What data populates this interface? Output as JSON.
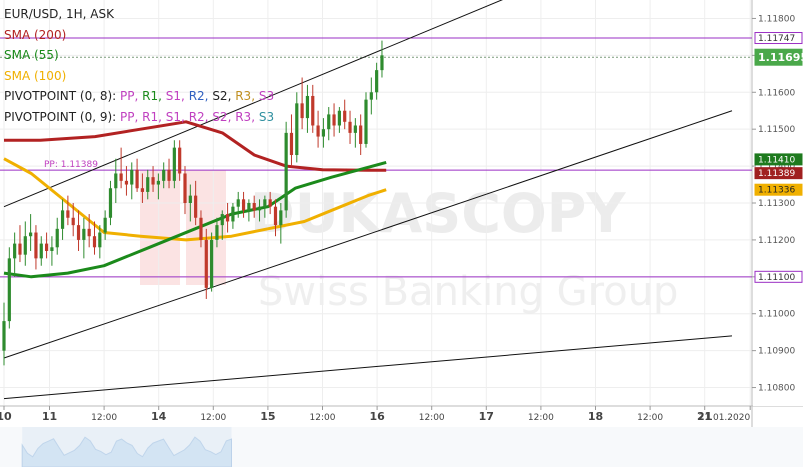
{
  "legend": {
    "symbol": "EUR/USD, 1H, ASK",
    "sma200": "SMA (200)",
    "sma55": "SMA (55)",
    "sma100": "SMA (100)",
    "pivot1_prefix": "PIVOTPOINT (0, 8):",
    "pivot2_prefix": "PIVOTPOINT (0, 9):",
    "pivot_levels": [
      "PP,",
      "R1,",
      "S1,",
      "R2,",
      "S2,",
      "R3,",
      "S3"
    ]
  },
  "colors": {
    "sma200": "#b22222",
    "sma55": "#1b8a1b",
    "sma100": "#f0b000",
    "pivot": "#9a2fc4",
    "bull": "#2e8b2e",
    "bear": "#c0392b",
    "pp": "#c040c0",
    "r1": "#1b8a1b",
    "s1": "#c040c0",
    "r2": "#3060c0",
    "s2": "#c040c0",
    "r3": "#c09020",
    "s3": "#c040c0",
    "r3b": "#c040c0",
    "s3b": "#3090a0"
  },
  "watermark": {
    "brand": "DUKASCOPY",
    "sub": "Swiss Banking Group"
  },
  "chart_data": {
    "type": "candlestick",
    "symbol": "EUR/USD",
    "timeframe": "1H",
    "ylim": [
      1.1075,
      1.1185
    ],
    "y_ticks": [
      "1.11800",
      "1.11700",
      "1.11600",
      "1.11500",
      "1.11400",
      "1.11300",
      "1.11200",
      "1.11100",
      "1.11000",
      "1.10900",
      "1.10800"
    ],
    "x_ticks": [
      {
        "label": "10",
        "t": 0
      },
      {
        "label": "11",
        "t": 10
      },
      {
        "label": "12:00",
        "t": 22
      },
      {
        "label": "14",
        "t": 34
      },
      {
        "label": "12:00",
        "t": 46
      },
      {
        "label": "15",
        "t": 58
      },
      {
        "label": "12:00",
        "t": 70
      },
      {
        "label": "16",
        "t": 82
      },
      {
        "label": "12:00",
        "t": 94
      },
      {
        "label": "17",
        "t": 106
      },
      {
        "label": "12:00",
        "t": 118
      },
      {
        "label": "18",
        "t": 130
      },
      {
        "label": "12:00",
        "t": 142
      },
      {
        "label": "21",
        "t": 154
      },
      {
        "label": "21.01.2020",
        "t": 164
      }
    ],
    "price_labels": [
      {
        "text": "1.11747",
        "value": 1.11747,
        "style": "purple-outline"
      },
      {
        "text": "1.11695",
        "value": 1.11695,
        "style": "green-fill"
      },
      {
        "text": "1.11410",
        "value": 1.1141,
        "style": "darkgreen-fill"
      },
      {
        "text": "1.11389",
        "value": 1.11389,
        "style": "red-fill"
      },
      {
        "text": "1.11336",
        "value": 1.11336,
        "style": "yellow-fill"
      },
      {
        "text": "1.11100",
        "value": 1.111,
        "style": "purple-outline"
      }
    ],
    "pivot_label": {
      "text": "PP: 1.11389",
      "value": 1.11389
    },
    "horizontal_lines": [
      {
        "value": 1.11747,
        "color": "#9a2fc4"
      },
      {
        "value": 1.11389,
        "color": "#9a2fc4"
      },
      {
        "value": 1.111,
        "color": "#9a2fc4"
      }
    ],
    "trendlines": [
      {
        "t1": 0,
        "v1": 1.1129,
        "t2": 125,
        "v2": 1.1193
      },
      {
        "t1": 0,
        "v1": 1.1088,
        "t2": 160,
        "v2": 1.1155
      },
      {
        "t1": 0,
        "v1": 1.1077,
        "t2": 160,
        "v2": 1.1094
      }
    ],
    "candles": [
      {
        "o": 1.109,
        "h": 1.1103,
        "l": 1.1086,
        "c": 1.1098
      },
      {
        "o": 1.1098,
        "h": 1.1118,
        "l": 1.1096,
        "c": 1.1115
      },
      {
        "o": 1.1115,
        "h": 1.1122,
        "l": 1.111,
        "c": 1.1119
      },
      {
        "o": 1.1119,
        "h": 1.1124,
        "l": 1.1114,
        "c": 1.1116
      },
      {
        "o": 1.1116,
        "h": 1.1125,
        "l": 1.1113,
        "c": 1.1121
      },
      {
        "o": 1.1121,
        "h": 1.1127,
        "l": 1.1117,
        "c": 1.1122
      },
      {
        "o": 1.1122,
        "h": 1.1124,
        "l": 1.1112,
        "c": 1.1115
      },
      {
        "o": 1.1115,
        "h": 1.1121,
        "l": 1.1113,
        "c": 1.1119
      },
      {
        "o": 1.1119,
        "h": 1.1122,
        "l": 1.1115,
        "c": 1.1117
      },
      {
        "o": 1.1117,
        "h": 1.1121,
        "l": 1.1113,
        "c": 1.1118
      },
      {
        "o": 1.1118,
        "h": 1.1126,
        "l": 1.1116,
        "c": 1.1123
      },
      {
        "o": 1.1123,
        "h": 1.1131,
        "l": 1.112,
        "c": 1.1128
      },
      {
        "o": 1.1128,
        "h": 1.1132,
        "l": 1.1124,
        "c": 1.1126
      },
      {
        "o": 1.1126,
        "h": 1.113,
        "l": 1.1121,
        "c": 1.1124
      },
      {
        "o": 1.1124,
        "h": 1.1128,
        "l": 1.1117,
        "c": 1.112
      },
      {
        "o": 1.112,
        "h": 1.1126,
        "l": 1.1115,
        "c": 1.1123
      },
      {
        "o": 1.1123,
        "h": 1.1127,
        "l": 1.1118,
        "c": 1.1121
      },
      {
        "o": 1.1121,
        "h": 1.1125,
        "l": 1.1116,
        "c": 1.1118
      },
      {
        "o": 1.1118,
        "h": 1.1124,
        "l": 1.1115,
        "c": 1.1122
      },
      {
        "o": 1.1122,
        "h": 1.1128,
        "l": 1.112,
        "c": 1.1126
      },
      {
        "o": 1.1126,
        "h": 1.1136,
        "l": 1.1124,
        "c": 1.1134
      },
      {
        "o": 1.1134,
        "h": 1.1142,
        "l": 1.113,
        "c": 1.1138
      },
      {
        "o": 1.1138,
        "h": 1.1145,
        "l": 1.1134,
        "c": 1.1136
      },
      {
        "o": 1.1136,
        "h": 1.114,
        "l": 1.1132,
        "c": 1.1135
      },
      {
        "o": 1.1135,
        "h": 1.1141,
        "l": 1.1131,
        "c": 1.1139
      },
      {
        "o": 1.1139,
        "h": 1.1142,
        "l": 1.1133,
        "c": 1.1134
      },
      {
        "o": 1.1134,
        "h": 1.1138,
        "l": 1.113,
        "c": 1.1133
      },
      {
        "o": 1.1133,
        "h": 1.1139,
        "l": 1.1131,
        "c": 1.1137
      },
      {
        "o": 1.1137,
        "h": 1.114,
        "l": 1.1133,
        "c": 1.1135
      },
      {
        "o": 1.1135,
        "h": 1.1138,
        "l": 1.1131,
        "c": 1.1136
      },
      {
        "o": 1.1136,
        "h": 1.1141,
        "l": 1.1134,
        "c": 1.1139
      },
      {
        "o": 1.1139,
        "h": 1.1142,
        "l": 1.1134,
        "c": 1.1136
      },
      {
        "o": 1.1136,
        "h": 1.1147,
        "l": 1.1134,
        "c": 1.1145
      },
      {
        "o": 1.1145,
        "h": 1.1147,
        "l": 1.1136,
        "c": 1.1138
      },
      {
        "o": 1.1138,
        "h": 1.114,
        "l": 1.1127,
        "c": 1.113
      },
      {
        "o": 1.113,
        "h": 1.1135,
        "l": 1.1125,
        "c": 1.1132
      },
      {
        "o": 1.1132,
        "h": 1.1136,
        "l": 1.1124,
        "c": 1.1126
      },
      {
        "o": 1.1126,
        "h": 1.1128,
        "l": 1.1118,
        "c": 1.112
      },
      {
        "o": 1.112,
        "h": 1.1123,
        "l": 1.1104,
        "c": 1.1107
      },
      {
        "o": 1.1107,
        "h": 1.1122,
        "l": 1.1106,
        "c": 1.112
      },
      {
        "o": 1.112,
        "h": 1.1126,
        "l": 1.1118,
        "c": 1.1124
      },
      {
        "o": 1.1124,
        "h": 1.1128,
        "l": 1.112,
        "c": 1.1127
      },
      {
        "o": 1.1127,
        "h": 1.113,
        "l": 1.1122,
        "c": 1.1125
      },
      {
        "o": 1.1125,
        "h": 1.113,
        "l": 1.1123,
        "c": 1.1129
      },
      {
        "o": 1.1129,
        "h": 1.1133,
        "l": 1.1126,
        "c": 1.1131
      },
      {
        "o": 1.1131,
        "h": 1.1133,
        "l": 1.1126,
        "c": 1.1128
      },
      {
        "o": 1.1128,
        "h": 1.1131,
        "l": 1.1125,
        "c": 1.113
      },
      {
        "o": 1.113,
        "h": 1.1132,
        "l": 1.1126,
        "c": 1.1128
      },
      {
        "o": 1.1128,
        "h": 1.1131,
        "l": 1.1125,
        "c": 1.1129
      },
      {
        "o": 1.1129,
        "h": 1.1132,
        "l": 1.1126,
        "c": 1.1131
      },
      {
        "o": 1.1131,
        "h": 1.1133,
        "l": 1.1127,
        "c": 1.1129
      },
      {
        "o": 1.1129,
        "h": 1.1131,
        "l": 1.1121,
        "c": 1.1124
      },
      {
        "o": 1.1124,
        "h": 1.113,
        "l": 1.1119,
        "c": 1.1128
      },
      {
        "o": 1.1128,
        "h": 1.1152,
        "l": 1.1126,
        "c": 1.1149
      },
      {
        "o": 1.1149,
        "h": 1.1154,
        "l": 1.114,
        "c": 1.1143
      },
      {
        "o": 1.1143,
        "h": 1.116,
        "l": 1.1141,
        "c": 1.1157
      },
      {
        "o": 1.1157,
        "h": 1.1164,
        "l": 1.115,
        "c": 1.1153
      },
      {
        "o": 1.1153,
        "h": 1.1162,
        "l": 1.1149,
        "c": 1.1159
      },
      {
        "o": 1.1159,
        "h": 1.1162,
        "l": 1.1149,
        "c": 1.1151
      },
      {
        "o": 1.1151,
        "h": 1.1155,
        "l": 1.1145,
        "c": 1.1148
      },
      {
        "o": 1.1148,
        "h": 1.1153,
        "l": 1.1145,
        "c": 1.115
      },
      {
        "o": 1.115,
        "h": 1.1156,
        "l": 1.1147,
        "c": 1.1154
      },
      {
        "o": 1.1154,
        "h": 1.1157,
        "l": 1.1148,
        "c": 1.1151
      },
      {
        "o": 1.1151,
        "h": 1.1156,
        "l": 1.1149,
        "c": 1.1155
      },
      {
        "o": 1.1155,
        "h": 1.1158,
        "l": 1.115,
        "c": 1.1152
      },
      {
        "o": 1.1152,
        "h": 1.1155,
        "l": 1.1146,
        "c": 1.1149
      },
      {
        "o": 1.1149,
        "h": 1.1153,
        "l": 1.1145,
        "c": 1.1151
      },
      {
        "o": 1.1151,
        "h": 1.1154,
        "l": 1.1143,
        "c": 1.1146
      },
      {
        "o": 1.1146,
        "h": 1.116,
        "l": 1.1145,
        "c": 1.1158
      },
      {
        "o": 1.1158,
        "h": 1.1164,
        "l": 1.1154,
        "c": 1.116
      },
      {
        "o": 1.116,
        "h": 1.1168,
        "l": 1.1158,
        "c": 1.1166
      },
      {
        "o": 1.1166,
        "h": 1.1174,
        "l": 1.1164,
        "c": 1.117
      }
    ],
    "sma200": [
      {
        "t": 0,
        "v": 1.1147
      },
      {
        "t": 8,
        "v": 1.1147
      },
      {
        "t": 20,
        "v": 1.1148
      },
      {
        "t": 30,
        "v": 1.115
      },
      {
        "t": 40,
        "v": 1.1152
      },
      {
        "t": 48,
        "v": 1.1149
      },
      {
        "t": 55,
        "v": 1.1143
      },
      {
        "t": 62,
        "v": 1.114
      },
      {
        "t": 70,
        "v": 1.1139
      },
      {
        "t": 80,
        "v": 1.11389
      },
      {
        "t": 84,
        "v": 1.11389
      }
    ],
    "sma55": [
      {
        "t": 0,
        "v": 1.1111
      },
      {
        "t": 6,
        "v": 1.111
      },
      {
        "t": 14,
        "v": 1.1111
      },
      {
        "t": 22,
        "v": 1.1113
      },
      {
        "t": 32,
        "v": 1.1118
      },
      {
        "t": 42,
        "v": 1.1123
      },
      {
        "t": 50,
        "v": 1.1127
      },
      {
        "t": 58,
        "v": 1.1129
      },
      {
        "t": 64,
        "v": 1.1134
      },
      {
        "t": 72,
        "v": 1.1137
      },
      {
        "t": 78,
        "v": 1.1139
      },
      {
        "t": 84,
        "v": 1.1141
      }
    ],
    "sma100": [
      {
        "t": 0,
        "v": 1.1142
      },
      {
        "t": 6,
        "v": 1.1138
      },
      {
        "t": 14,
        "v": 1.113
      },
      {
        "t": 22,
        "v": 1.1122
      },
      {
        "t": 30,
        "v": 1.1121
      },
      {
        "t": 40,
        "v": 1.112
      },
      {
        "t": 50,
        "v": 1.1121
      },
      {
        "t": 58,
        "v": 1.1123
      },
      {
        "t": 66,
        "v": 1.1125
      },
      {
        "t": 74,
        "v": 1.1129
      },
      {
        "t": 80,
        "v": 1.1132
      },
      {
        "t": 84,
        "v": 1.11336
      }
    ],
    "volume_scroller": {
      "t_start": 4,
      "t_end": 50
    }
  }
}
